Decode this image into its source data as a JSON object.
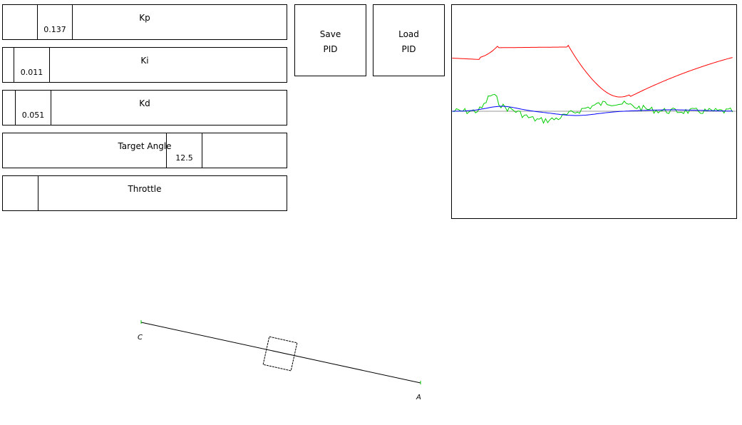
{
  "sliders": {
    "kp": {
      "label": "Kp",
      "value": "0.137"
    },
    "ki": {
      "label": "Ki",
      "value": "0.011"
    },
    "kd": {
      "label": "Kd",
      "value": "0.051"
    },
    "target": {
      "label": "Target Angle",
      "value": "12.5"
    },
    "throttle": {
      "label": "Throttle"
    }
  },
  "buttons": {
    "save": {
      "line1": "Save",
      "line2": "PID"
    },
    "load": {
      "line1": "Load",
      "line2": "PID"
    }
  },
  "graph": {
    "colors": {
      "angle": "#ff0000",
      "output": "#00cc00",
      "filtered": "#0000ff",
      "baseline": "#999999"
    }
  },
  "sim": {
    "label_left": "C",
    "label_right": "A",
    "endpoint_color": "#00cc00"
  }
}
